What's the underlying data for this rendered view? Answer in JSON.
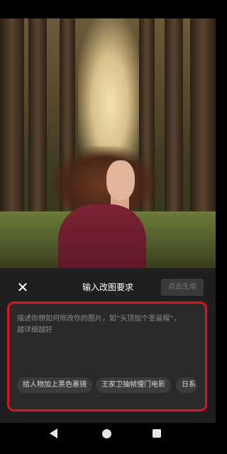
{
  "sheet": {
    "title": "输入改图要求",
    "generate_label": "点击生成",
    "close_icon": "close-icon"
  },
  "input": {
    "placeholder_line1": "描述你想如何修改你的图片，如“头顶加个圣诞帽”，",
    "placeholder_line2": "越详细越好"
  },
  "suggestions": [
    {
      "label": "给人物加上黑色墨镜"
    },
    {
      "label": "王家卫抽帧慢门电影"
    },
    {
      "label": "日系"
    }
  ],
  "colors": {
    "panel_border": "#e3101f",
    "sheet_bg": "#1f1f1f",
    "chip_bg": "#3b3b3b"
  },
  "navigation": {
    "back_icon": "back-triangle-icon",
    "home_icon": "home-circle-icon",
    "recents_icon": "recents-square-icon"
  }
}
